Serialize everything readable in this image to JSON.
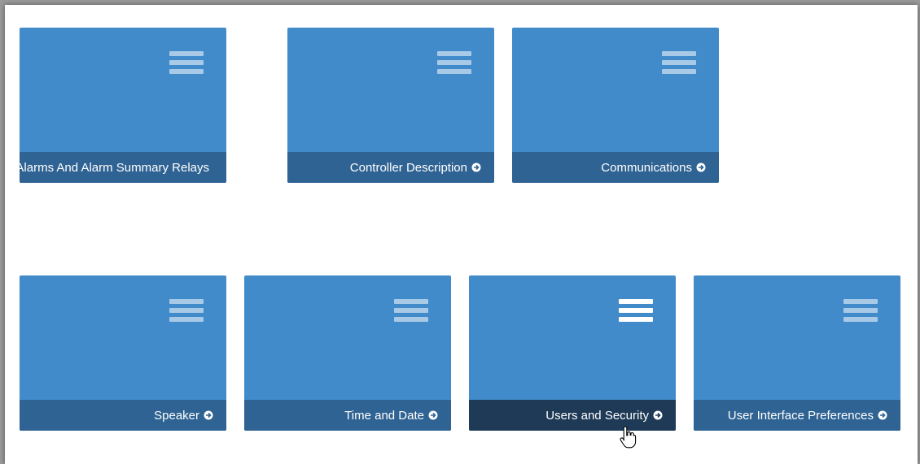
{
  "tiles": [
    {
      "label": "Alarms And Alarm Summary Relays"
    },
    {
      "label": "Controller Description"
    },
    {
      "label": "Communications"
    },
    {
      "label": "Speaker"
    },
    {
      "label": "Time and Date"
    },
    {
      "label": "Users and Security"
    },
    {
      "label": "User Interface Preferences"
    }
  ],
  "icons": {
    "menu": "hamburger-icon",
    "arrow": "circle-arrow-right-icon",
    "cursor": "hand-pointer-icon"
  },
  "colors": {
    "tile": "#428bca",
    "footer": "#2f6393",
    "footer_hover": "#1e3a56"
  }
}
